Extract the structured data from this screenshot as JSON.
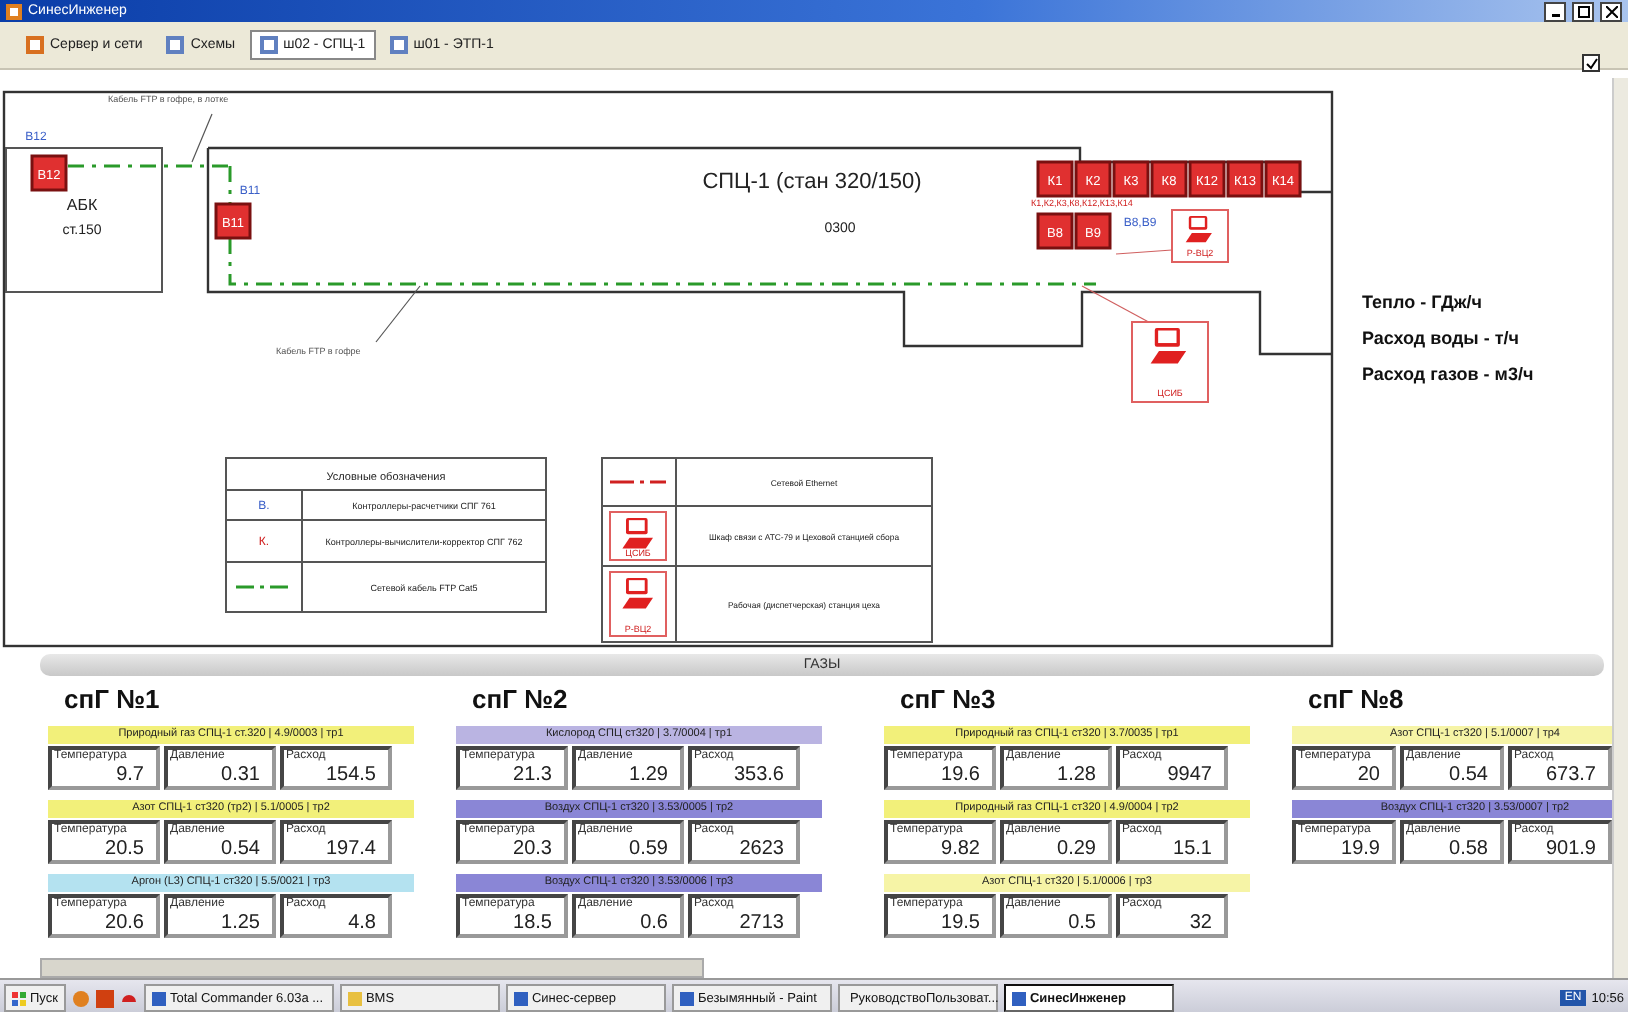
{
  "window": {
    "title": "СинесИнженер"
  },
  "tabs": [
    {
      "label": "Сервер и сети",
      "selected": false
    },
    {
      "label": "Схемы",
      "selected": false
    },
    {
      "label": "ш02 - СПЦ-1",
      "selected": true
    },
    {
      "label": "ш01 - ЭТП-1",
      "selected": false
    }
  ],
  "toolbar_check": {
    "checked": true
  },
  "diagram": {
    "shop_title": "СПЦ-1 (стан 320/150)",
    "shop_code": "0300",
    "building": {
      "name": "АБК",
      "number": "ст.150"
    },
    "sensors": [
      {
        "label": "В12"
      },
      {
        "label": "В11"
      },
      {
        "label": "К1"
      },
      {
        "label": "К2"
      },
      {
        "label": "К3"
      },
      {
        "label": "К8"
      },
      {
        "label": "К12"
      },
      {
        "label": "К13"
      },
      {
        "label": "К14"
      },
      {
        "label": "В8"
      },
      {
        "label": "В9"
      }
    ],
    "notes": [
      {
        "text": "В12",
        "kind": "meter"
      },
      {
        "text": "В11",
        "kind": "meter"
      },
      {
        "text": "К1,К2,К3,К8,К12,К13,К14",
        "kind": "corrector"
      },
      {
        "text": "В8,В9",
        "kind": "meter"
      },
      {
        "text": "Кабель FTP в гофре, в лотке",
        "kind": "cable"
      },
      {
        "text": "Кабель FTP в гофре",
        "kind": "cable"
      }
    ],
    "workstations": [
      {
        "label": "Р-ВЦ2"
      },
      {
        "label": "ЦСИБ"
      }
    ],
    "legend_left": {
      "title": "Условные обозначения",
      "rows": [
        {
          "symbol": "В.",
          "text": "Контроллеры-расчетчики СПГ 761",
          "kind": "meter"
        },
        {
          "symbol": "К.",
          "text": "Контроллеры-вычислители-корректор СПГ 762",
          "kind": "corrector"
        },
        {
          "text": "Сетевой кабель FTP Cat5",
          "kind": "cable"
        }
      ]
    },
    "legend_right": {
      "rows": [
        {
          "text": "Сетевой Ethernet",
          "kind": "ethernet"
        },
        {
          "symbol": "ЦСИБ",
          "text": "Шкаф связи с АТС-79 и Цеховой станцией сбора",
          "kind": "station"
        },
        {
          "symbol": "Р-ВЦ2",
          "text": "Рабочая (диспетчерская) станция цеха",
          "kind": "station"
        }
      ]
    }
  },
  "units": [
    "Тепло - ГДж/ч",
    "Расход воды - т/ч",
    "Расход газов - м3/ч"
  ],
  "gases": {
    "title": "ГАЗЫ",
    "groups": [
      {
        "title": "спГ №1",
        "items": [
          {
            "caption": "Природный газ СПЦ-1 ст.320 | 4.9/0003 | тр1",
            "color": "#f2f07a",
            "cells": [
              {
                "label": "Температура",
                "value": "9.7"
              },
              {
                "label": "Давление",
                "value": "0.31"
              },
              {
                "label": "Расход",
                "value": "154.5"
              }
            ]
          },
          {
            "caption": "Азот СПЦ-1 ст320 (тр2) | 5.1/0005 | тр2",
            "color": "#f2f07a",
            "cells": [
              {
                "label": "Температура",
                "value": "20.5"
              },
              {
                "label": "Давление",
                "value": "0.54"
              },
              {
                "label": "Расход",
                "value": "197.4"
              }
            ]
          },
          {
            "caption": "Аргон (L3) СПЦ-1 ст320 | 5.5/0021 | тр3",
            "color": "#b4e2f0",
            "cells": [
              {
                "label": "Температура",
                "value": "20.6"
              },
              {
                "label": "Давление",
                "value": "1.25"
              },
              {
                "label": "Расход",
                "value": "4.8"
              }
            ]
          }
        ]
      },
      {
        "title": "спГ №2",
        "items": [
          {
            "caption": "Кислород СПЦ ст320 | 3.7/0004 | тр1",
            "color": "#bab4e2",
            "cells": [
              {
                "label": "Температура",
                "value": "21.3"
              },
              {
                "label": "Давление",
                "value": "1.29"
              },
              {
                "label": "Расход",
                "value": "353.6"
              }
            ]
          },
          {
            "caption": "Воздух СПЦ-1 ст320 | 3.53/0005 | тр2",
            "color": "#8a86d6",
            "cells": [
              {
                "label": "Температура",
                "value": "20.3"
              },
              {
                "label": "Давление",
                "value": "0.59"
              },
              {
                "label": "Расход",
                "value": "2623"
              }
            ]
          },
          {
            "caption": "Воздух СПЦ-1 ст320 | 3.53/0006 | тр3",
            "color": "#8a86d6",
            "cells": [
              {
                "label": "Температура",
                "value": "18.5"
              },
              {
                "label": "Давление",
                "value": "0.6"
              },
              {
                "label": "Расход",
                "value": "2713"
              }
            ]
          }
        ]
      },
      {
        "title": "спГ №3",
        "items": [
          {
            "caption": "Природный газ СПЦ-1 ст320 | 3.7/0035 | тр1",
            "color": "#f2f07a",
            "cells": [
              {
                "label": "Температура",
                "value": "19.6"
              },
              {
                "label": "Давление",
                "value": "1.28"
              },
              {
                "label": "Расход",
                "value": "9947"
              }
            ]
          },
          {
            "caption": "Природный газ СПЦ-1 ст320 | 4.9/0004 | тр2",
            "color": "#f2f07a",
            "cells": [
              {
                "label": "Температура",
                "value": "9.82"
              },
              {
                "label": "Давление",
                "value": "0.29"
              },
              {
                "label": "Расход",
                "value": "15.1"
              }
            ]
          },
          {
            "caption": "Азот СПЦ-1 ст320 | 5.1/0006 | тр3",
            "color": "#f6f4a6",
            "cells": [
              {
                "label": "Температура",
                "value": "19.5"
              },
              {
                "label": "Давление",
                "value": "0.5"
              },
              {
                "label": "Расход",
                "value": "32"
              }
            ]
          }
        ]
      },
      {
        "title": "спГ №8",
        "items": [
          {
            "caption": "Азот СПЦ-1 ст320 | 5.1/0007 | тр4",
            "color": "#f6f4a6",
            "cells": [
              {
                "label": "Температура",
                "value": "20"
              },
              {
                "label": "Давление",
                "value": "0.54"
              },
              {
                "label": "Расход",
                "value": "673.7"
              }
            ]
          },
          {
            "caption": "Воздух СПЦ-1 ст320 | 3.53/0007 | тр2",
            "color": "#8a86d6",
            "cells": [
              {
                "label": "Температура",
                "value": "19.9"
              },
              {
                "label": "Давление",
                "value": "0.58"
              },
              {
                "label": "Расход",
                "value": "901.9"
              }
            ]
          }
        ]
      }
    ]
  },
  "taskbar": {
    "start": "Пуск",
    "buttons": [
      {
        "label": "Total Commander 6.03a ...",
        "selected": false
      },
      {
        "label": "BMS",
        "selected": false
      },
      {
        "label": "Синес-сервер",
        "selected": false
      },
      {
        "label": "Безымянный - Paint",
        "selected": false
      },
      {
        "label": "РуководствоПользоват...",
        "selected": false
      },
      {
        "label": "СинесИнженер",
        "selected": true
      }
    ],
    "language": "EN",
    "time": "10:56"
  }
}
